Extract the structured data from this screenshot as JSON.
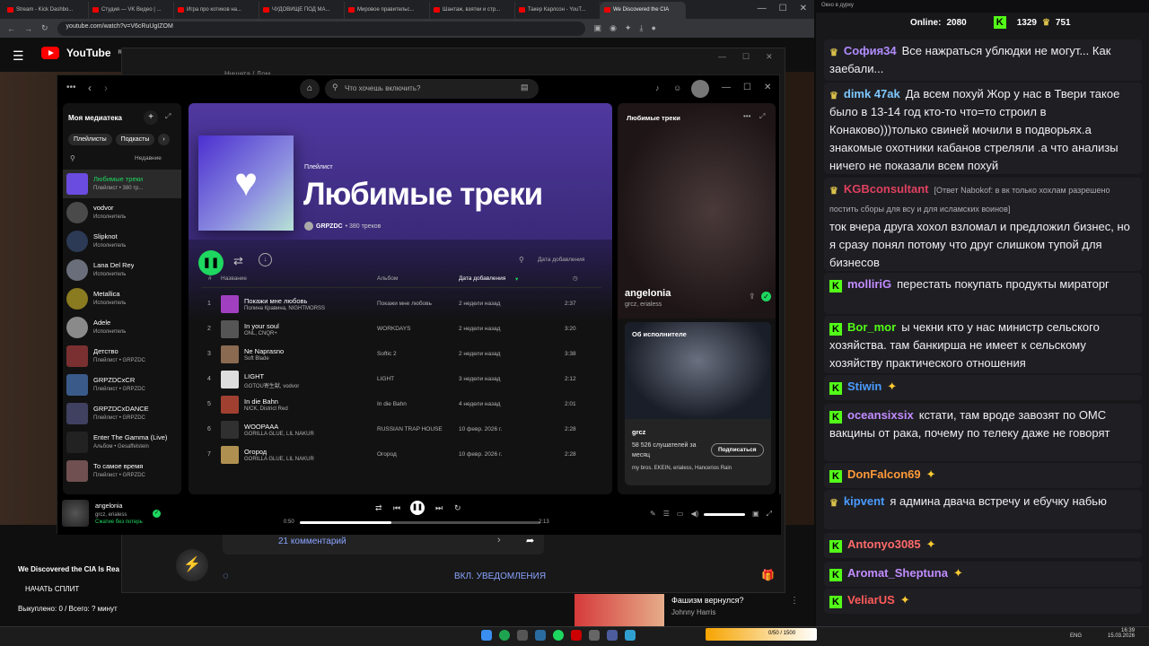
{
  "browser": {
    "tabs": [
      "Stream - Kick Dashbo...",
      "Студия — VK Видео | ...",
      "Игра про котиков на...",
      "ЧУДОВИЩЕ ПОД МА...",
      "Мировое правительс...",
      "Шантаж, взятки и стр...",
      "Такер Карлсон - YouT...",
      "We Discovered the CIA"
    ],
    "url": "youtube.com/watch?v=V6cRuUgIZOM"
  },
  "youtube": {
    "logo": "YouTube",
    "region": "RU",
    "video_title": "We Discovered the CIA Is Rea",
    "split_button": "НАЧАТЬ СПЛИТ",
    "split_status": "Выкуплено: 0 / Всего: ? минут",
    "comments": "21 комментарий",
    "notify": "ВКЛ. УВЕДОМЛЕНИЯ",
    "rec_title": "Фашизм вернулся?",
    "rec_channel": "Johnny Harris",
    "bg_header": "Нищета / Дом..."
  },
  "spotify": {
    "search_placeholder": "Что хочешь включить?",
    "library": {
      "title": "Моя медиатека",
      "chips": [
        "Плейлисты",
        "Подкасты"
      ],
      "sort": "Недавние",
      "items": [
        {
          "name": "Любимые треки",
          "sub": "Плейлист • 380 тр...",
          "active": true,
          "color": "#6a4ce0"
        },
        {
          "name": "vodvor",
          "sub": "Исполнитель",
          "color": "#4a4a4a"
        },
        {
          "name": "Slipknot",
          "sub": "Исполнитель",
          "color": "#2c3a55"
        },
        {
          "name": "Lana Del Rey",
          "sub": "Исполнитель",
          "color": "#6a6e7a"
        },
        {
          "name": "Metallica",
          "sub": "Исполнитель",
          "color": "#8a7a20"
        },
        {
          "name": "Adele",
          "sub": "Исполнитель",
          "color": "#8a8a8a"
        },
        {
          "name": "Детство",
          "sub": "Плейлист • GRPZDC",
          "color": "#7a3030"
        },
        {
          "name": "GRPZDCxCR",
          "sub": "Плейлист • GRPZDC",
          "color": "#3a5a8a"
        },
        {
          "name": "GRPZDCxDANCE",
          "sub": "Плейлист • GRPZDC",
          "color": "#404060"
        },
        {
          "name": "Enter The Gamma (Live)",
          "sub": "Альбом • Gesaffelstein",
          "color": "#222"
        },
        {
          "name": "То самое время",
          "sub": "Плейлист • GRPZDC",
          "color": "#705050"
        }
      ]
    },
    "playlist": {
      "type": "Плейлист",
      "title": "Любимые треки",
      "owner": "GRPZDC",
      "count": "• 380 треков",
      "sort": "Дата добавления"
    },
    "columns": {
      "num": "#",
      "title": "Название",
      "album": "Альбом",
      "date": "Дата добавления"
    },
    "tracks": [
      {
        "n": "1",
        "title": "Покажи мне любовь",
        "artist": "Полина Кравина, NIGHTMORSS",
        "album": "Покажи мне любовь",
        "date": "2 недели назад",
        "dur": "2:37",
        "color": "#a040c0"
      },
      {
        "n": "2",
        "title": "In your soul",
        "artist": "ONL, CNQR+",
        "album": "WORKDAYS",
        "date": "2 недели назад",
        "dur": "3:20",
        "color": "#555"
      },
      {
        "n": "3",
        "title": "Ne Naprasno",
        "artist": "Soft Blade",
        "album": "Softic 2",
        "date": "2 недели назад",
        "dur": "3:38",
        "color": "#8a6a50"
      },
      {
        "n": "4",
        "title": "LIGHT",
        "artist": "GOTOU寄生獣, vodvor",
        "album": "LIGHT",
        "date": "3 недели назад",
        "dur": "2:12",
        "color": "#ddd"
      },
      {
        "n": "5",
        "title": "In die Bahn",
        "artist": "N/CK, District Red",
        "album": "In die Bahn",
        "date": "4 недели назад",
        "dur": "2:01",
        "color": "#a04030"
      },
      {
        "n": "6",
        "title": "WOOPAAA",
        "artist": "GORILLA GLUE, LIL NAKUR",
        "album": "RUSSIAN TRAP HOUSE",
        "date": "10 февр. 2026 г.",
        "dur": "2:28",
        "color": "#303030"
      },
      {
        "n": "7",
        "title": "Огород",
        "artist": "GORILLA GLUE, LIL NAKUR",
        "album": "Огород",
        "date": "10 февр. 2026 г.",
        "dur": "2:28",
        "color": "#b09050"
      }
    ],
    "right": {
      "header": "Любимые треки",
      "artist": "angelonia",
      "feat": "grcz, erialess",
      "about": "Об исполнителе",
      "about_name": "grcz",
      "listeners": "58 526 слушателей за месяц",
      "follow": "Подписаться",
      "related": "my bros. EKEIN, erialess, Hancerios Rain"
    },
    "player": {
      "title": "angelonia",
      "artists": "grcz, erialess",
      "quality": "Сжатие без потерь",
      "elapsed": "0:50",
      "total": "2:13",
      "progress": 0.38
    }
  },
  "chat": {
    "header": "Окно в дурку",
    "online_label": "Online:",
    "online": "2080",
    "k_count": "1329",
    "crown_count": "751",
    "messages": [
      {
        "user": "София34",
        "color": "#b18cff",
        "text": "Все нажраться ублюдки не могут... Как заебали..."
      },
      {
        "user": "dimk 47ak",
        "color": "#7ec8ff",
        "text": "Да всем похуй Жор у нас в Твери такое было в 13-14 год кто-то что=то строил в Конаково)))только свиней мочили в подворьях.а знакомые охотники кабанов стреляли .а что анализы ничего не показали всем похуй"
      },
      {
        "user": "KGBconsultant",
        "color": "#e04060",
        "reply": "[Ответ Nabokof: в вк только хохлам разрешено постить сборы для всу и для исламских воинов]",
        "text": "ток вчера друга хохол взломал и предложил бизнес, но я сразу понял потому что друг слишком тупой для бизнесов"
      },
      {
        "user": "molliriG",
        "color": "#c18cff",
        "text": "перестать покупать продукты мираторг"
      },
      {
        "user": "Bor_mor",
        "color": "#53fc18",
        "text": "ы чекни кто у нас министр сельского хозяйства. там банкирша не имеет к сельскому хозяйству практического отношения"
      },
      {
        "user": "Stiwin",
        "color": "#4a9bff",
        "text": ""
      },
      {
        "user": "oceansixsix",
        "color": "#c18cff",
        "text": "кстати, там вроде завозят по ОМС вакцины от рака, почему по телеку даже не говорят"
      },
      {
        "user": "DonFalcon69",
        "color": "#ff9a3a",
        "text": ""
      },
      {
        "user": "kipvent",
        "color": "#4a9bff",
        "text": "я админа двача встречу и ебучку набью"
      },
      {
        "user": "Antonyo3085",
        "color": "#ff6a6a",
        "text": ""
      },
      {
        "user": "Aromat_Sheptuna",
        "color": "#c18cff",
        "text": ""
      },
      {
        "user": "VeliarUS",
        "color": "#ff5a5a",
        "text": ""
      }
    ]
  },
  "taskbar": {
    "lang": "ENG",
    "time": "16:39",
    "date": "15.03.2026",
    "widget": "0/50 / 1500"
  }
}
